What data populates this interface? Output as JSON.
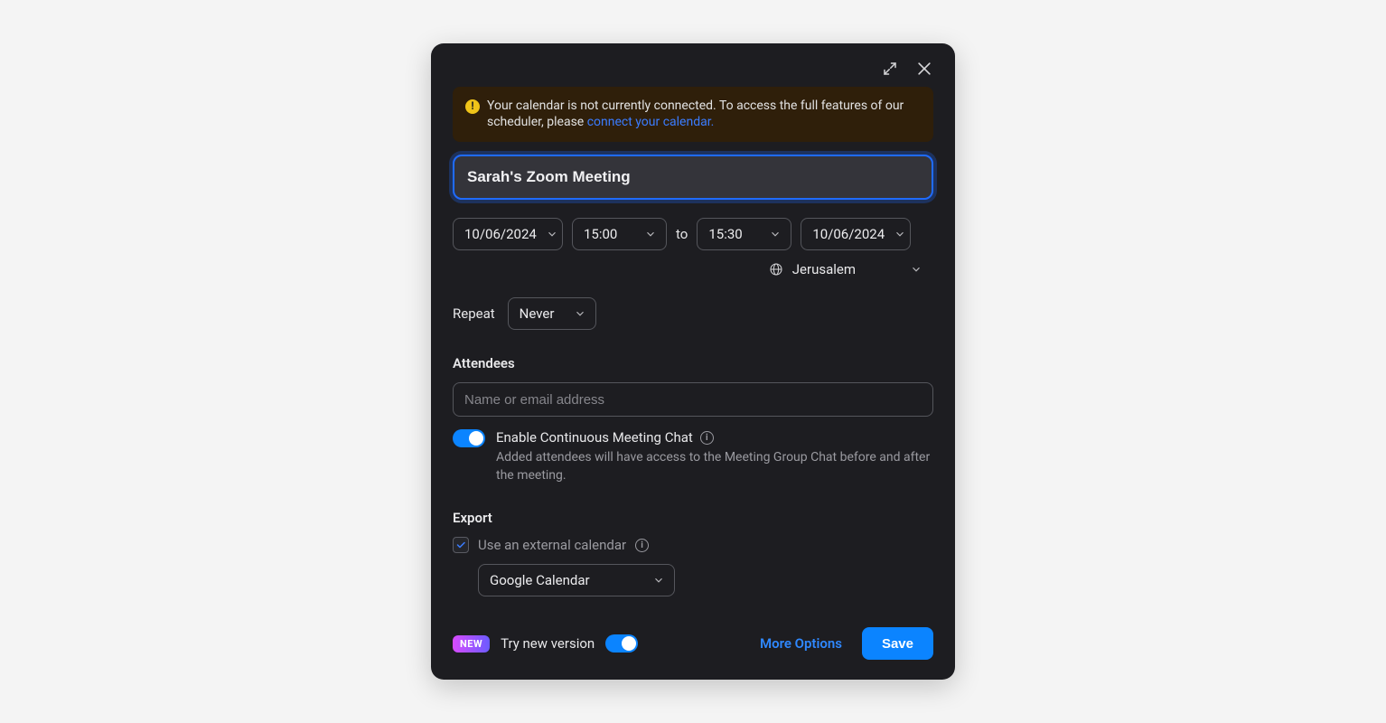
{
  "warning": {
    "text_a": "Your calendar is not currently connected. To access the full features of our scheduler, please ",
    "link": "connect your calendar."
  },
  "meeting": {
    "title": "Sarah's Zoom Meeting",
    "start_date": "10/06/2024",
    "start_time": "15:00",
    "to_label": "to",
    "end_time": "15:30",
    "end_date": "10/06/2024",
    "timezone": "Jerusalem"
  },
  "repeat": {
    "label": "Repeat",
    "value": "Never"
  },
  "attendees": {
    "heading": "Attendees",
    "placeholder": "Name or email address"
  },
  "chat": {
    "title": "Enable Continuous Meeting Chat",
    "desc": "Added attendees will have access to the Meeting Group Chat before and after the meeting."
  },
  "export": {
    "heading": "Export",
    "checkbox_label": "Use an external calendar",
    "calendar": "Google Calendar"
  },
  "footer": {
    "new_badge": "NEW",
    "try_new": "Try new version",
    "more_options": "More Options",
    "save": "Save"
  }
}
